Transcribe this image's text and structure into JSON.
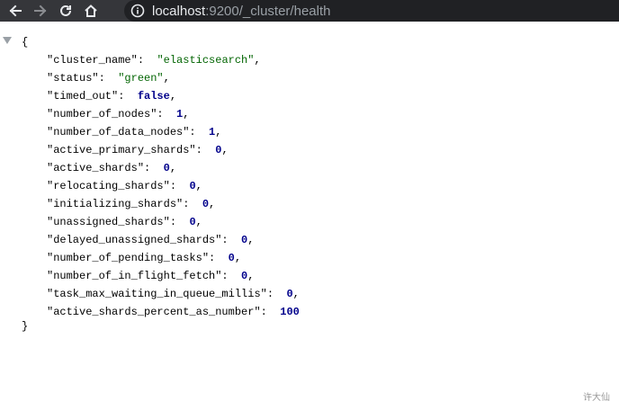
{
  "browser": {
    "url_host": "localhost",
    "url_rest": ":9200/_cluster/health"
  },
  "json": {
    "open_brace": "{",
    "close_brace": "}",
    "entries": [
      {
        "key": "\"cluster_name\":",
        "value": "\"elasticsearch\"",
        "type": "string",
        "comma": ","
      },
      {
        "key": "\"status\":",
        "value": "\"green\"",
        "type": "string",
        "comma": ","
      },
      {
        "key": "\"timed_out\":",
        "value": "false",
        "type": "keyword",
        "comma": ","
      },
      {
        "key": "\"number_of_nodes\":",
        "value": "1",
        "type": "number",
        "comma": ","
      },
      {
        "key": "\"number_of_data_nodes\":",
        "value": "1",
        "type": "number",
        "comma": ","
      },
      {
        "key": "\"active_primary_shards\":",
        "value": "0",
        "type": "number",
        "comma": ","
      },
      {
        "key": "\"active_shards\":",
        "value": "0",
        "type": "number",
        "comma": ","
      },
      {
        "key": "\"relocating_shards\":",
        "value": "0",
        "type": "number",
        "comma": ","
      },
      {
        "key": "\"initializing_shards\":",
        "value": "0",
        "type": "number",
        "comma": ","
      },
      {
        "key": "\"unassigned_shards\":",
        "value": "0",
        "type": "number",
        "comma": ","
      },
      {
        "key": "\"delayed_unassigned_shards\":",
        "value": "0",
        "type": "number",
        "comma": ","
      },
      {
        "key": "\"number_of_pending_tasks\":",
        "value": "0",
        "type": "number",
        "comma": ","
      },
      {
        "key": "\"number_of_in_flight_fetch\":",
        "value": "0",
        "type": "number",
        "comma": ","
      },
      {
        "key": "\"task_max_waiting_in_queue_millis\":",
        "value": "0",
        "type": "number",
        "comma": ","
      },
      {
        "key": "\"active_shards_percent_as_number\":",
        "value": "100",
        "type": "number",
        "comma": ""
      }
    ]
  },
  "watermark": "许大仙",
  "colors": {
    "toolbar_bg": "#35363a",
    "address_bg": "#202124",
    "string_value": "#006400",
    "number_value": "#00008b"
  },
  "icons": [
    "back-arrow-icon",
    "forward-arrow-icon",
    "reload-icon",
    "home-icon",
    "info-icon",
    "collapse-triangle-icon"
  ]
}
